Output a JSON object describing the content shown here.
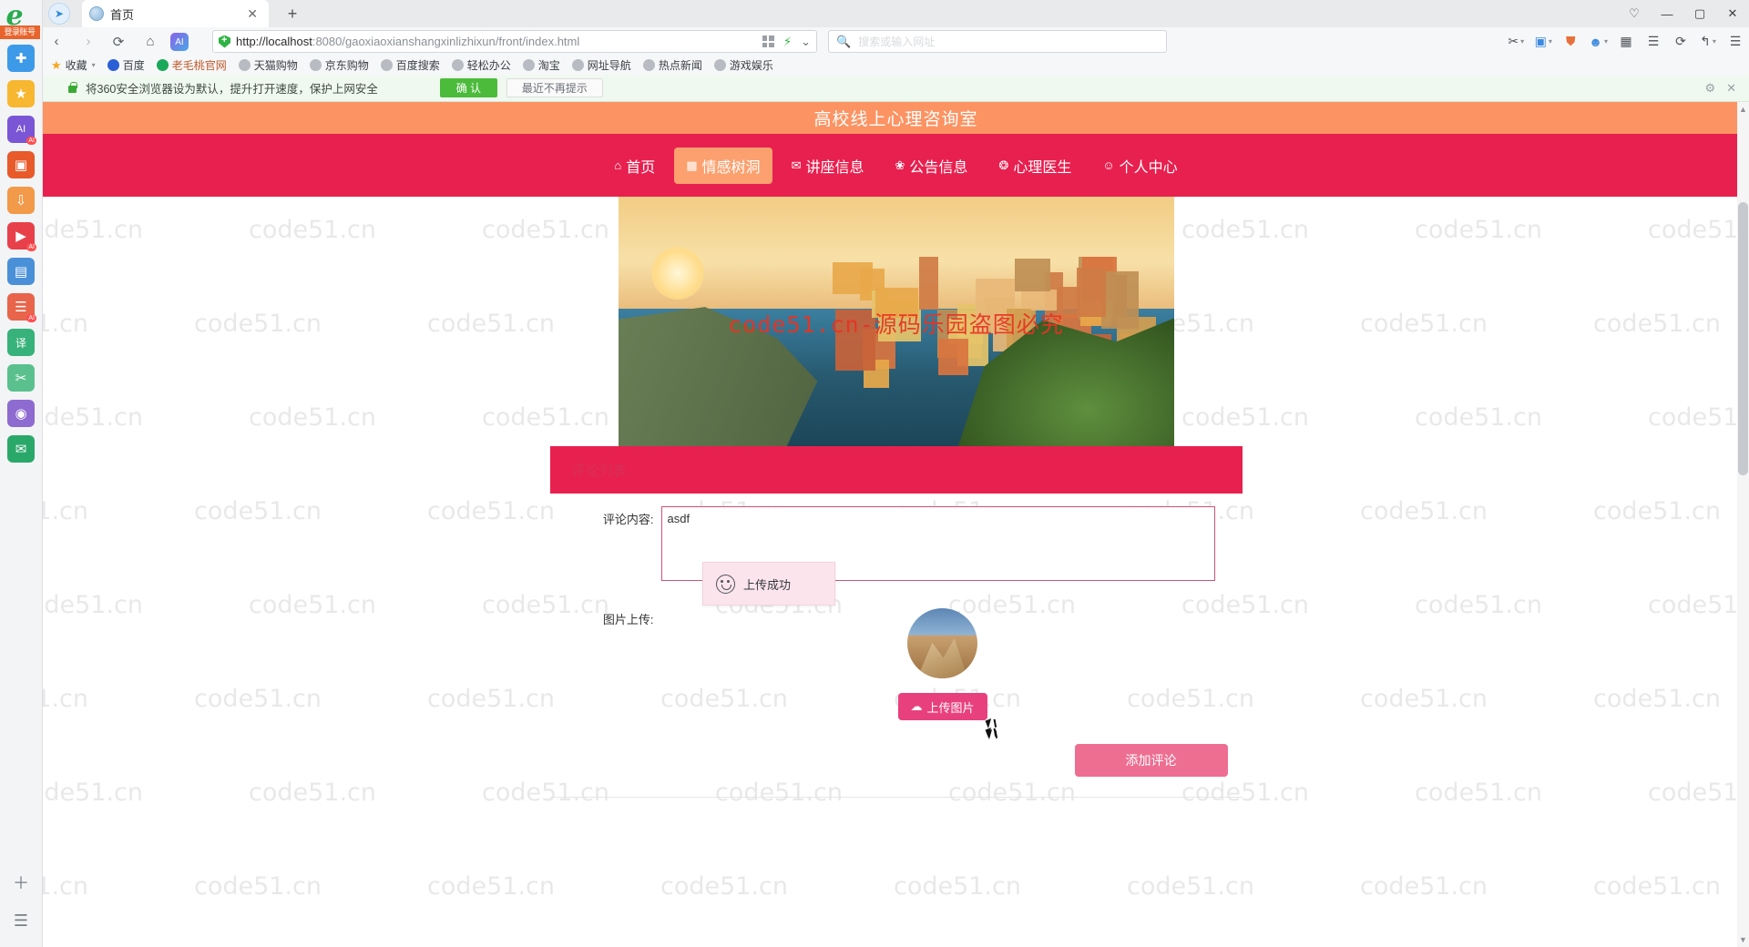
{
  "browser": {
    "sidebar": {
      "login_badge": "登录账号",
      "icons": [
        {
          "name": "ie-logo-icon",
          "glyph": "e",
          "color": "#2aab4f"
        },
        {
          "name": "add-panel-icon",
          "glyph": "✚",
          "color": "#3d9ae8",
          "badge": ""
        },
        {
          "name": "favorites-star-icon",
          "glyph": "★",
          "color": "#f5a623",
          "badge": ""
        },
        {
          "name": "ai-assistant-icon",
          "glyph": "AI",
          "color": "#7a56d6",
          "badge": "AI"
        },
        {
          "name": "photo-gallery-icon",
          "glyph": "▣",
          "color": "#e85a2a",
          "badge": ""
        },
        {
          "name": "download-manager-icon",
          "glyph": "⇩",
          "color": "#f2994a",
          "badge": ""
        },
        {
          "name": "video-icon",
          "glyph": "▶",
          "color": "#e8404a",
          "badge": "AI"
        },
        {
          "name": "chart-icon",
          "glyph": "▤",
          "color": "#4a90d9",
          "badge": ""
        },
        {
          "name": "notes-icon",
          "glyph": "☰",
          "color": "#e8644a",
          "badge": "AI"
        },
        {
          "name": "translate-icon",
          "glyph": "译",
          "color": "#37b27a",
          "badge": ""
        },
        {
          "name": "scissors-icon",
          "glyph": "✂",
          "color": "#5ac18e",
          "badge": ""
        },
        {
          "name": "eye-protect-icon",
          "glyph": "◉",
          "color": "#8e6bd0",
          "badge": ""
        },
        {
          "name": "mail-icon",
          "glyph": "✉",
          "color": "#2aa86a",
          "badge": ""
        }
      ],
      "bottom_icons": [
        {
          "name": "add-tool-icon",
          "glyph": "+"
        },
        {
          "name": "more-tools-icon",
          "glyph": "☰"
        }
      ]
    },
    "tab": {
      "title": "首页",
      "close_label": "✕",
      "new_tab_label": "+"
    },
    "window_controls": [
      {
        "name": "window-skin-button",
        "glyph": "♡"
      },
      {
        "name": "window-minimize-button",
        "glyph": "—"
      },
      {
        "name": "window-maximize-button",
        "glyph": "▢"
      },
      {
        "name": "window-close-button",
        "glyph": "✕"
      }
    ],
    "toolbar": {
      "back_label": "‹",
      "forward_label": "›",
      "reload_label": "⟳",
      "home_label": "⌂",
      "ai_button_label": "AI",
      "url_protocol": "http://",
      "url_host": "localhost",
      "url_path": ":8080/gaoxiaoxianshangxinlizhixun/front/index.html",
      "url_full": "http://localhost:8080/gaoxiaoxianshangxinlizhixun/front/index.html",
      "lightning_label": "⚡",
      "chevron_label": "⌄",
      "search_placeholder": "搜索或输入网址",
      "right_buttons": [
        {
          "name": "cut-tool-button",
          "glyph": "✂"
        },
        {
          "name": "capture-button",
          "glyph": "▣"
        },
        {
          "name": "shield-button",
          "glyph": "🛡"
        },
        {
          "name": "user-account-button",
          "glyph": "☺"
        },
        {
          "name": "apps-grid-button",
          "glyph": "▦"
        },
        {
          "name": "menu-button",
          "glyph": "☰"
        },
        {
          "name": "sync-button",
          "glyph": "⟳"
        },
        {
          "name": "history-back-button",
          "glyph": "↰"
        },
        {
          "name": "settings-button",
          "glyph": "⚙"
        }
      ]
    },
    "bookmarks": [
      {
        "name": "bookmark-favorites",
        "label": "收藏",
        "color": "#f5a623",
        "star": true
      },
      {
        "name": "bookmark-baidu",
        "label": "百度",
        "color": "#2a5fd6"
      },
      {
        "name": "bookmark-laomaotao",
        "label": "老毛桃官网",
        "color": "#1aa85a"
      },
      {
        "name": "bookmark-tmall",
        "label": "天猫购物",
        "color": "#b8bcc2"
      },
      {
        "name": "bookmark-jd",
        "label": "京东购物",
        "color": "#b8bcc2"
      },
      {
        "name": "bookmark-baidu-search",
        "label": "百度搜索",
        "color": "#b8bcc2"
      },
      {
        "name": "bookmark-office",
        "label": "轻松办公",
        "color": "#b8bcc2"
      },
      {
        "name": "bookmark-taobao",
        "label": "淘宝",
        "color": "#b8bcc2"
      },
      {
        "name": "bookmark-nav",
        "label": "网址导航",
        "color": "#b8bcc2"
      },
      {
        "name": "bookmark-news",
        "label": "热点新闻",
        "color": "#b8bcc2"
      },
      {
        "name": "bookmark-games",
        "label": "游戏娱乐",
        "color": "#b8bcc2"
      }
    ],
    "notification": {
      "text": "将360安全浏览器设为默认，提升打开速度，保护上网安全",
      "confirm_label": "确 认",
      "dismiss_label": "最近不再提示",
      "settings_glyph": "⚙",
      "close_glyph": "✕"
    }
  },
  "site": {
    "title": "高校线上心理咨询室",
    "nav": [
      {
        "name": "nav-home",
        "icon": "⌂",
        "label": "首页",
        "active": false
      },
      {
        "name": "nav-emotion-tree-hole",
        "icon": "▦",
        "label": "情感树洞",
        "active": true
      },
      {
        "name": "nav-lecture-info",
        "icon": "✉",
        "label": "讲座信息",
        "active": false
      },
      {
        "name": "nav-announcement",
        "icon": "❀",
        "label": "公告信息",
        "active": false
      },
      {
        "name": "nav-psychologist",
        "icon": "❂",
        "label": "心理医生",
        "active": false
      },
      {
        "name": "nav-personal-center",
        "icon": "☺",
        "label": "个人中心",
        "active": false
      }
    ],
    "hero": {
      "watermark": "code51.cn-源码乐园盗图必究"
    },
    "comment_section": {
      "header": "评论列表",
      "content_label": "评论内容:",
      "content_value": "asdf",
      "content_placeholder": "",
      "image_label": "图片上传:",
      "upload_button": "上传图片",
      "upload_icon": "☁",
      "submit_button": "添加评论"
    },
    "toast": {
      "message": "上传成功",
      "icon": "smiley-icon"
    },
    "page_watermark": "code51.cn"
  },
  "colors": {
    "brand_orange": "#fc9362",
    "brand_pink": "#e8204f",
    "accent_pink": "#ee6e92",
    "upload_pink": "#e8407c",
    "nav_active": "#fba06e",
    "notify_green": "#4cbb3c"
  }
}
